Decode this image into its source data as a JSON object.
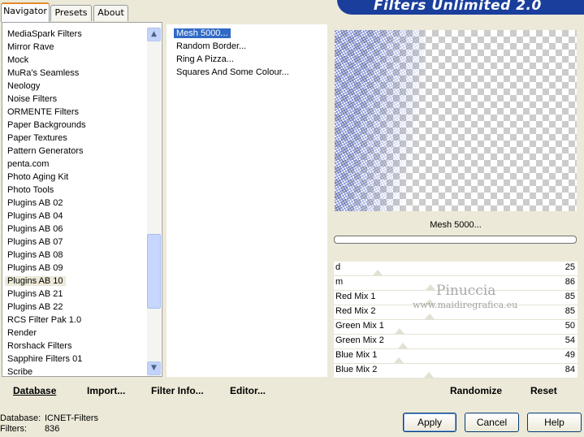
{
  "tabs": [
    "Navigator",
    "Presets",
    "About"
  ],
  "banner_title": "Filters Unlimited 2.0",
  "categories": [
    "MediaSpark Filters",
    "Mirror Rave",
    "Mock",
    "MuRa's Seamless",
    "Neology",
    "Noise Filters",
    "ORMENTE Filters",
    "Paper Backgrounds",
    "Paper Textures",
    "Pattern Generators",
    "penta.com",
    "Photo Aging Kit",
    "Photo Tools",
    "Plugins AB 02",
    "Plugins AB 04",
    "Plugins AB 06",
    "Plugins AB 07",
    "Plugins AB 08",
    "Plugins AB 09",
    "Plugins AB 10",
    "Plugins AB 21",
    "Plugins AB 22",
    "RCS Filter Pak 1.0",
    "Render",
    "Rorshack Filters",
    "Sapphire Filters 01",
    "Scribe"
  ],
  "selected_category": "Plugins AB 10",
  "filters": [
    "Mesh 5000...",
    "Random Border...",
    "Ring A Pizza...",
    "Squares And Some Colour..."
  ],
  "selected_filter": "Mesh 5000...",
  "left_buttons": {
    "database": "Database",
    "import": "Import...",
    "filter_info": "Filter Info...",
    "editor": "Editor..."
  },
  "filter_name": "Mesh 5000...",
  "parameters": [
    {
      "label": "d",
      "value": "25"
    },
    {
      "label": "m",
      "value": "86"
    },
    {
      "label": "Red Mix 1",
      "value": "85"
    },
    {
      "label": "Red Mix 2",
      "value": "85"
    },
    {
      "label": "Green Mix 1",
      "value": "50"
    },
    {
      "label": "Green Mix 2",
      "value": "54"
    },
    {
      "label": "Blue Mix 1",
      "value": "49"
    },
    {
      "label": "Blue Mix 2",
      "value": "84"
    }
  ],
  "watermark": {
    "line1": "Pinuccia",
    "line2": "www.maidiregrafica.eu"
  },
  "right_buttons": {
    "randomize": "Randomize",
    "reset": "Reset"
  },
  "status": {
    "database_label": "Database:",
    "database_value": "ICNET-Filters",
    "filters_label": "Filters:",
    "filters_value": "836"
  },
  "dialog_buttons": {
    "apply": "Apply",
    "cancel": "Cancel",
    "help": "Help"
  },
  "colors": {
    "selection_blue": "#316ac5",
    "banner": "#1a3e9c",
    "tab_accent": "#e68b2c"
  }
}
